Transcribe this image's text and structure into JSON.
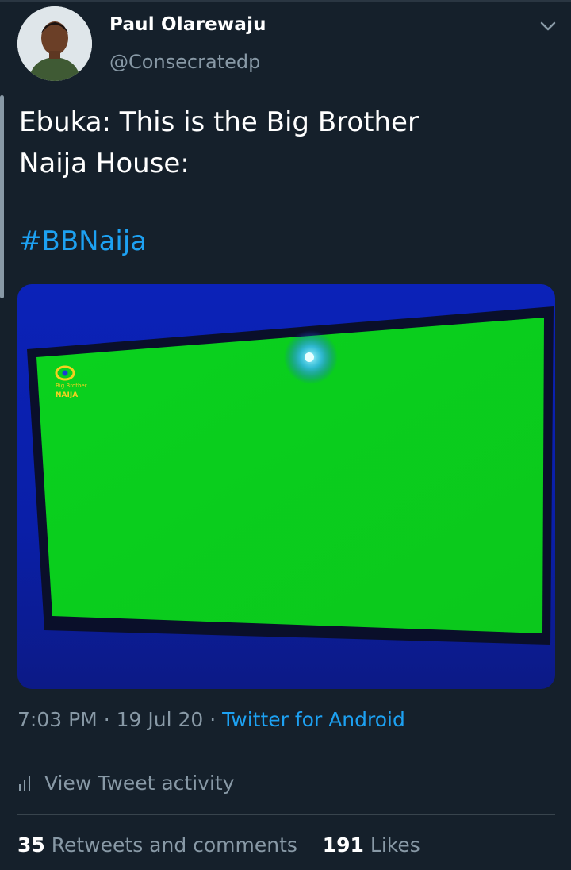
{
  "author": {
    "display_name": "Paul Olarewaju",
    "handle": "@Consecratedp"
  },
  "tweet": {
    "text_line1": "Ebuka: This is the Big Brother",
    "text_line2": "Naija House:",
    "hashtag": "#BBNaija"
  },
  "media": {
    "logo_line1": "Big Brother",
    "logo_line2": "NAIJA"
  },
  "meta": {
    "time": "7:03 PM",
    "separator": "·",
    "date": "19 Jul 20",
    "source": "Twitter for Android"
  },
  "activity": {
    "label": "View Tweet activity"
  },
  "stats": {
    "retweets_count": "35",
    "retweets_label": "Retweets and comments",
    "likes_count": "191",
    "likes_label": "Likes"
  },
  "colors": {
    "background": "#15202b",
    "accent": "#1da1f2",
    "secondary_text": "#8899a6"
  }
}
